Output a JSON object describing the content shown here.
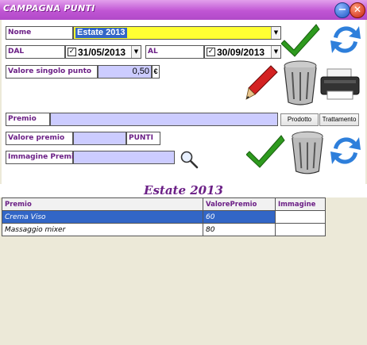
{
  "window": {
    "title": "CAMPAGNA PUNTI",
    "minimize_label": "−",
    "close_label": "✕"
  },
  "form": {
    "nome_label": "Nome",
    "nome_value": "Estate 2013",
    "dal_label": "DAL",
    "dal_value": "31/05/2013",
    "dal_checked": "✓",
    "al_label": "AL",
    "al_value": "30/09/2013",
    "al_checked": "✓",
    "valore_punto_label": "Valore singolo punto",
    "valore_punto_value": "0,50",
    "valore_punto_currency": "€",
    "premio_label": "Premio",
    "premio_value": "",
    "valore_premio_label": "Valore premio",
    "valore_premio_value": "",
    "punti_label": "PUNTI",
    "immagine_label": "Immagine Premio",
    "immagine_value": "",
    "prodotto_button": "Prodotto",
    "trattamento_button": "Trattamento"
  },
  "table": {
    "title": "Estate 2013",
    "columns": [
      "Premio",
      "ValorePremio",
      "Immagine"
    ],
    "rows": [
      {
        "premio": "Crema Viso",
        "valore": "60",
        "immagine": ""
      },
      {
        "premio": "Massaggio mixer",
        "valore": "80",
        "immagine": ""
      }
    ]
  },
  "colors": {
    "accent": "#6b1f86",
    "highlight_field": "#ffff33",
    "input_field": "#ccccff",
    "selection": "#3266c6"
  },
  "icons": [
    "check-icon",
    "refresh-icon",
    "pen-icon",
    "trash-icon",
    "printer-icon",
    "magnifier-icon"
  ]
}
